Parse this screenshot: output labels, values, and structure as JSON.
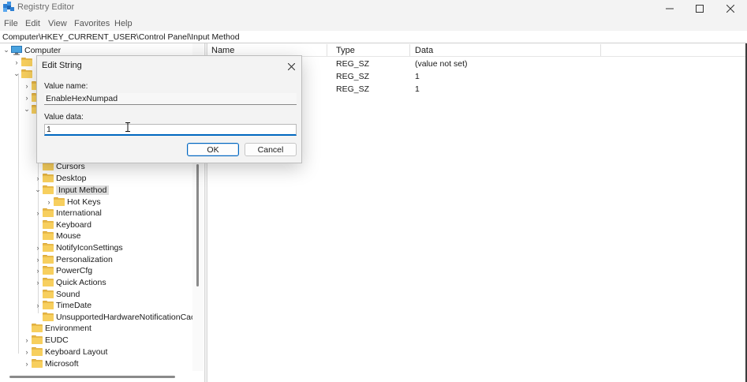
{
  "window": {
    "title": "Registry Editor",
    "accent": "#0067c0"
  },
  "menu": [
    "File",
    "Edit",
    "View",
    "Favorites",
    "Help"
  ],
  "address": "Computer\\HKEY_CURRENT_USER\\Control Panel\\Input Method",
  "tree": {
    "root": "Computer",
    "items": [
      {
        "label": "Cursors",
        "expander": "",
        "selected": false
      },
      {
        "label": "Desktop",
        "expander": "collapsed",
        "selected": false
      },
      {
        "label": "Input Method",
        "expander": "expanded",
        "selected": true
      },
      {
        "label": "Hot Keys",
        "expander": "collapsed",
        "selected": false
      },
      {
        "label": "International",
        "expander": "collapsed",
        "selected": false
      },
      {
        "label": "Keyboard",
        "expander": "",
        "selected": false
      },
      {
        "label": "Mouse",
        "expander": "",
        "selected": false
      },
      {
        "label": "NotifyIconSettings",
        "expander": "collapsed",
        "selected": false
      },
      {
        "label": "Personalization",
        "expander": "collapsed",
        "selected": false
      },
      {
        "label": "PowerCfg",
        "expander": "collapsed",
        "selected": false
      },
      {
        "label": "Quick Actions",
        "expander": "collapsed",
        "selected": false
      },
      {
        "label": "Sound",
        "expander": "",
        "selected": false
      },
      {
        "label": "TimeDate",
        "expander": "collapsed",
        "selected": false
      },
      {
        "label": "UnsupportedHardwareNotificationCac",
        "expander": "",
        "selected": false
      },
      {
        "label": "Environment",
        "expander": "",
        "selected": false
      },
      {
        "label": "EUDC",
        "expander": "collapsed",
        "selected": false
      },
      {
        "label": "Keyboard Layout",
        "expander": "collapsed",
        "selected": false
      },
      {
        "label": "Microsoft",
        "expander": "collapsed",
        "selected": false
      }
    ]
  },
  "list": {
    "columns": {
      "name": "Name",
      "type": "Type",
      "data": "Data"
    },
    "rows": [
      {
        "type": "REG_SZ",
        "data": "(value not set)"
      },
      {
        "type": "REG_SZ",
        "data": "1"
      },
      {
        "type": "REG_SZ",
        "data": "1"
      }
    ]
  },
  "dialog": {
    "title": "Edit String",
    "value_name_label": "Value name:",
    "value_name": "EnableHexNumpad",
    "value_data_label": "Value data:",
    "value_data": "1",
    "ok_label": "OK",
    "cancel_label": "Cancel"
  }
}
